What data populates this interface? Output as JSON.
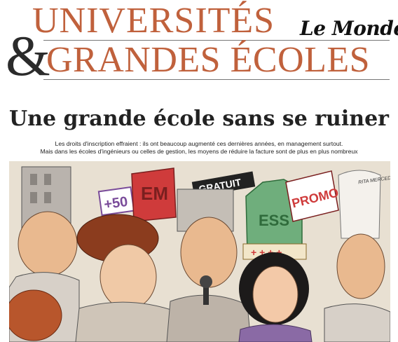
{
  "masthead": {
    "line1": "UNIVERSITÉS",
    "ampersand": "&",
    "line2": "GRANDES ÉCOLES",
    "brand": "Le Monde"
  },
  "article": {
    "headline": "Une grande école sans se ruiner",
    "deck_line1": "Les droits d'inscription effraient : ils ont beaucoup augmenté ces dernières années, en management surtout.",
    "deck_line2": "Mais dans les écoles d'ingénieurs ou celles de gestion, les moyens de réduire la facture sont de plus en plus nombreux"
  },
  "illustration": {
    "hat_texts": [
      "+50",
      "EM",
      "GRATUIT",
      "PROMO",
      "ESS"
    ],
    "signature": "RITA MERCEDES",
    "colors": {
      "accent": "#c0613c",
      "sky": "#e8e0d2",
      "skin": "#e9b98f",
      "red_hat": "#cf3b3b",
      "green_crown": "#6fae7c",
      "purple": "#8a6aa5"
    }
  }
}
